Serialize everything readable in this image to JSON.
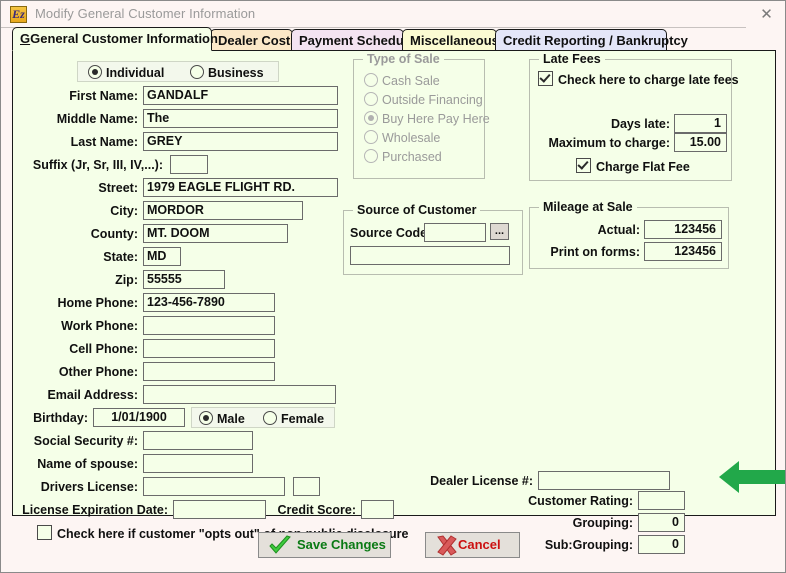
{
  "window": {
    "title": "Modify General Customer Information",
    "app_icon": "Ez",
    "close_icon": "✕"
  },
  "tabs": [
    {
      "label": "General Customer Information",
      "active": true,
      "color": "#F5FFE8"
    },
    {
      "label": "Dealer Costs",
      "active": false,
      "color": "#FBE8C8"
    },
    {
      "label": "Payment Schedule",
      "active": false,
      "color": "#F3E3F1"
    },
    {
      "label": "Miscellaneous",
      "active": false,
      "color": "#FBFBD2"
    },
    {
      "label": "Credit Reporting / Bankruptcy",
      "active": false,
      "color": "#E4E6F8"
    }
  ],
  "customer_type": {
    "options": [
      "Individual",
      "Business"
    ],
    "selected": "Individual"
  },
  "fields": {
    "first_name": {
      "label": "First Name:",
      "value": "GANDALF"
    },
    "middle_name": {
      "label": "Middle Name:",
      "value": "The"
    },
    "last_name": {
      "label": "Last Name:",
      "value": "GREY"
    },
    "suffix": {
      "label": "Suffix (Jr, Sr, III, IV,...):",
      "value": ""
    },
    "street": {
      "label": "Street:",
      "value": "1979 EAGLE FLIGHT RD."
    },
    "city": {
      "label": "City:",
      "value": "MORDOR"
    },
    "county": {
      "label": "County:",
      "value": "MT. DOOM"
    },
    "state": {
      "label": "State:",
      "value": "MD"
    },
    "zip": {
      "label": "Zip:",
      "value": "55555"
    },
    "home_phone": {
      "label": "Home Phone:",
      "value": "123-456-7890"
    },
    "work_phone": {
      "label": "Work Phone:",
      "value": ""
    },
    "cell_phone": {
      "label": "Cell Phone:",
      "value": ""
    },
    "other_phone": {
      "label": "Other Phone:",
      "value": ""
    },
    "email": {
      "label": "Email Address:",
      "value": ""
    },
    "birthday": {
      "label": "Birthday:",
      "value": "1/01/1900"
    },
    "ssn": {
      "label": "Social Security #:",
      "value": ""
    },
    "spouse": {
      "label": "Name of spouse:",
      "value": ""
    },
    "drivers_license": {
      "label": "Drivers License:",
      "value": ""
    },
    "dl_state": {
      "label": "",
      "value": ""
    },
    "license_exp": {
      "label": "License Expiration Date:",
      "value": ""
    },
    "credit_score": {
      "label": "Credit Score:",
      "value": ""
    },
    "dealer_license": {
      "label": "Dealer License #:",
      "value": ""
    },
    "customer_rating": {
      "label": "Customer Rating:",
      "value": ""
    },
    "grouping": {
      "label": "Grouping:",
      "value": "0"
    },
    "sub_grouping": {
      "label": "Sub:Grouping:",
      "value": "0"
    }
  },
  "gender": {
    "options": [
      "Male",
      "Female"
    ],
    "selected": "Male"
  },
  "opt_out": {
    "label": "Check here if customer \"opts out\" of non-public disclosure",
    "checked": false
  },
  "type_of_sale": {
    "title": "Type of Sale",
    "disabled": true,
    "options": [
      "Cash Sale",
      "Outside Financing",
      "Buy Here Pay Here",
      "Wholesale",
      "Purchased"
    ],
    "selected": "Buy Here Pay Here"
  },
  "late_fees": {
    "title": "Late Fees",
    "charge_late_fees": {
      "label": "Check here to charge late fees",
      "checked": true
    },
    "days_late": {
      "label": "Days late:",
      "value": "1"
    },
    "maximum_charge": {
      "label": "Maximum to charge:",
      "value": "15.00"
    },
    "charge_flat_fee": {
      "label": "Charge Flat Fee",
      "checked": true
    }
  },
  "source_of_customer": {
    "title": "Source of Customer",
    "source_code": {
      "label": "Source Code:",
      "value": ""
    },
    "browse_label": "...",
    "description": ""
  },
  "mileage_at_sale": {
    "title": "Mileage at Sale",
    "actual": {
      "label": "Actual:",
      "value": "123456"
    },
    "print_on_forms": {
      "label": "Print on forms:",
      "value": "123456"
    }
  },
  "buttons": {
    "save": {
      "label": "Save Changes",
      "icon": "check-icon",
      "color": "#0a7a14"
    },
    "cancel": {
      "label": "Cancel",
      "icon": "x-icon",
      "color": "#cc1111"
    }
  },
  "annotation": {
    "arrow_color": "#22A84A",
    "points_at": "Grouping:"
  }
}
